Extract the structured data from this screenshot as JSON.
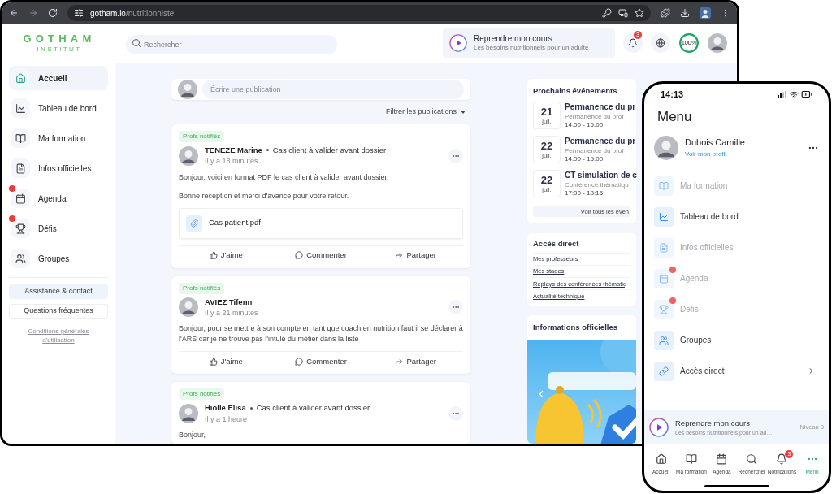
{
  "browser": {
    "url_domain": "gotham.io",
    "url_path": "/nutritionniste"
  },
  "header": {
    "logo_title": "GOTHAM",
    "logo_subtitle": "INSTITUT",
    "search_placeholder": "Rechercher",
    "resume": {
      "title": "Reprendre mon cours",
      "subtitle": "Les besoins nutritionnels pour un adulte"
    },
    "notifications_badge": "3",
    "progress": {
      "label": "100%",
      "level": 1
    }
  },
  "sidebar": {
    "items": [
      {
        "label": "Accueil",
        "selected": true,
        "dot": false
      },
      {
        "label": "Tableau de bord",
        "selected": false,
        "dot": false
      },
      {
        "label": "Ma formation",
        "selected": false,
        "dot": false
      },
      {
        "label": "Infos officielles",
        "selected": false,
        "dot": false
      },
      {
        "label": "Agenda",
        "selected": false,
        "dot": true
      },
      {
        "label": "Défis",
        "selected": false,
        "dot": true
      },
      {
        "label": "Groupes",
        "selected": false,
        "dot": false
      }
    ],
    "support_buttons": [
      {
        "label": "Assistance & contact",
        "kind": "filled"
      },
      {
        "label": "Questions fréquentes",
        "kind": "outlined"
      }
    ],
    "terms_link": "Conditions générales d'utilisation"
  },
  "feed": {
    "compose_placeholder": "Écrire une publication",
    "filter_label": "Filtrer les publications",
    "posts": [
      {
        "tag": "Profs notifiés",
        "author": "TENEZE Marine",
        "topic": "Cas client à valider avant dossier",
        "time": "Il y a 18 minutes",
        "paragraphs": [
          "Bonjour, voici en format PDF le cas client à valider avant dossier.",
          "Bonne réception et merci d'avance pour votre retour."
        ],
        "attachment": "Cas patient.pdf",
        "actions": [
          "J'aime",
          "Commenter",
          "Partager"
        ]
      },
      {
        "tag": "Profs notifiés",
        "author": "AVIEZ Tifenn",
        "time": "Il y a 21 minutes",
        "paragraphs": [
          "Bonjour, pour se mettre à son compte en tant que coach en nutrition faut il se déclarer à l'ARS car je ne trouve pas l'intulé du métier dans la liste"
        ],
        "actions": [
          "J'aime",
          "Commenter",
          "Partager"
        ]
      },
      {
        "tag": "Profs notifiés",
        "author": "Hiolle Elisa",
        "topic": "Cas client à valider avant dossier",
        "time": "Il y a 1 heure",
        "paragraphs": [
          "Bonjour,"
        ]
      }
    ]
  },
  "right": {
    "events": {
      "title": "Prochains événements",
      "items": [
        {
          "day": "21",
          "month": "juil.",
          "title": "Permanence du pr",
          "subtitle": "Permanence du prof",
          "time": "14:00 - 15:00"
        },
        {
          "day": "22",
          "month": "juil.",
          "title": "Permanence du pr",
          "subtitle": "Permanence du prof",
          "time": "14:00 - 15:00"
        },
        {
          "day": "22",
          "month": "juil.",
          "title": "CT simulation de c",
          "subtitle": "Conférence thématiqu",
          "time": "17:00 - 18:15"
        }
      ],
      "see_all": "Voir tous les évén"
    },
    "access": {
      "title": "Accès direct",
      "links": [
        "Mes professeurs",
        "Mes stages",
        "Replays des conférences thématiq",
        "Actualité technique"
      ]
    },
    "info": {
      "title": "Informations officielles"
    }
  },
  "phone": {
    "time": "14:13",
    "title": "Menu",
    "profile": {
      "name": "Dubois Camille",
      "link": "Voir mon profil"
    },
    "items": [
      {
        "label": "Ma formation",
        "disabled": true,
        "dot": false,
        "chevron": false
      },
      {
        "label": "Tableau de bord",
        "disabled": false,
        "dot": false,
        "chevron": false
      },
      {
        "label": "Infos officielles",
        "disabled": true,
        "dot": false,
        "chevron": false
      },
      {
        "label": "Agenda",
        "disabled": true,
        "dot": true,
        "chevron": false
      },
      {
        "label": "Défis",
        "disabled": true,
        "dot": true,
        "chevron": false
      },
      {
        "label": "Groupes",
        "disabled": false,
        "dot": false,
        "chevron": false
      },
      {
        "label": "Accès direct",
        "disabled": false,
        "dot": false,
        "chevron": true
      }
    ],
    "resume": {
      "title": "Reprendre mon cours",
      "subtitle": "Les besoins nutritionnels pour un ad…",
      "level": "Niveau 3"
    },
    "nav": [
      {
        "label": "Accueil",
        "selected": false
      },
      {
        "label": "Ma formation",
        "selected": false
      },
      {
        "label": "Agenda",
        "selected": false
      },
      {
        "label": "Rechercher",
        "selected": false
      },
      {
        "label": "Notifications",
        "selected": false,
        "badge": "3"
      },
      {
        "label": "Menu",
        "selected": true
      }
    ]
  }
}
